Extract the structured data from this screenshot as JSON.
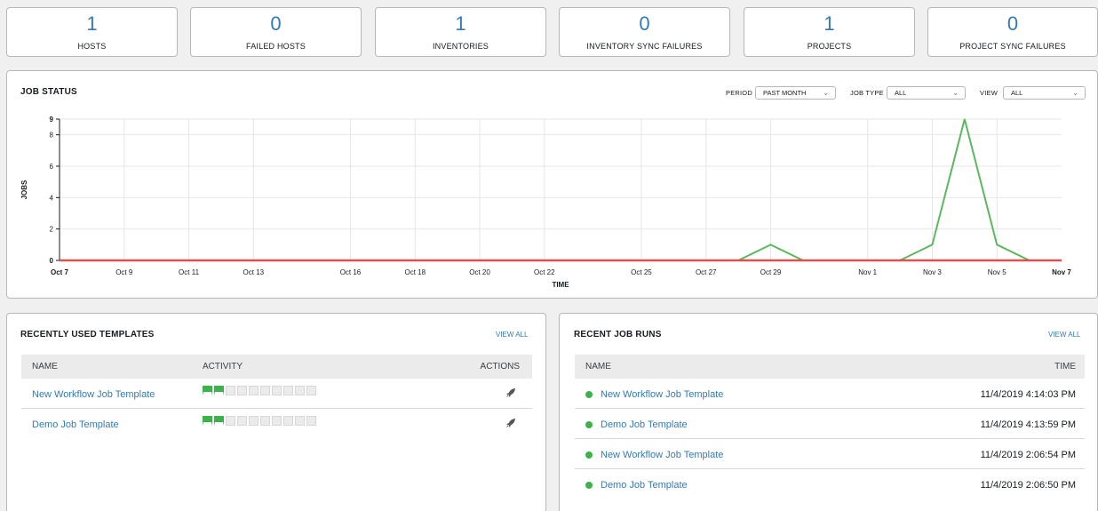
{
  "stats": [
    {
      "value": "1",
      "label": "HOSTS"
    },
    {
      "value": "0",
      "label": "FAILED HOSTS"
    },
    {
      "value": "1",
      "label": "INVENTORIES"
    },
    {
      "value": "0",
      "label": "INVENTORY SYNC FAILURES"
    },
    {
      "value": "1",
      "label": "PROJECTS"
    },
    {
      "value": "0",
      "label": "PROJECT SYNC FAILURES"
    }
  ],
  "job_status": {
    "title": "JOB STATUS",
    "filters": {
      "period_label": "PERIOD",
      "period_value": "PAST MONTH",
      "job_type_label": "JOB TYPE",
      "job_type_value": "ALL",
      "view_label": "VIEW",
      "view_value": "ALL"
    }
  },
  "chart_data": {
    "type": "line",
    "xlabel": "TIME",
    "ylabel": "JOBS",
    "ylim": [
      0,
      9
    ],
    "yticks": [
      0,
      2,
      4,
      6,
      8,
      9
    ],
    "x": [
      "Oct 7",
      "Oct 8",
      "Oct 9",
      "Oct 10",
      "Oct 11",
      "Oct 12",
      "Oct 13",
      "Oct 14",
      "Oct 15",
      "Oct 16",
      "Oct 17",
      "Oct 18",
      "Oct 19",
      "Oct 20",
      "Oct 21",
      "Oct 22",
      "Oct 23",
      "Oct 24",
      "Oct 25",
      "Oct 26",
      "Oct 27",
      "Oct 28",
      "Oct 29",
      "Oct 30",
      "Oct 31",
      "Nov 1",
      "Nov 2",
      "Nov 3",
      "Nov 4",
      "Nov 5",
      "Nov 6",
      "Nov 7"
    ],
    "xtick_labels": [
      "Oct 7",
      "Oct 9",
      "Oct 11",
      "Oct 13",
      "Oct 16",
      "Oct 18",
      "Oct 20",
      "Oct 22",
      "Oct 25",
      "Oct 27",
      "Oct 29",
      "Nov 1",
      "Nov 3",
      "Nov 5",
      "Nov 7"
    ],
    "bold_xticks": [
      "Oct 7",
      "Nov 7"
    ],
    "series": [
      {
        "color": "#5cb85c",
        "values": [
          0,
          0,
          0,
          0,
          0,
          0,
          0,
          0,
          0,
          0,
          0,
          0,
          0,
          0,
          0,
          0,
          0,
          0,
          0,
          0,
          0,
          0,
          1,
          0,
          0,
          0,
          0,
          1,
          9,
          1,
          0,
          0
        ]
      },
      {
        "color": "#d9534f",
        "values": [
          0,
          0,
          0,
          0,
          0,
          0,
          0,
          0,
          0,
          0,
          0,
          0,
          0,
          0,
          0,
          0,
          0,
          0,
          0,
          0,
          0,
          0,
          0,
          0,
          0,
          0,
          0,
          0,
          0,
          0,
          0,
          0
        ]
      }
    ],
    "grid": true
  },
  "templates": {
    "title": "RECENTLY USED TEMPLATES",
    "view_all": "VIEW ALL",
    "columns": {
      "name": "NAME",
      "activity": "ACTIVITY",
      "actions": "ACTIONS"
    },
    "rows": [
      {
        "name": "New Workflow Job Template",
        "activity": [
          "success",
          "success",
          "none",
          "none",
          "none",
          "none",
          "none",
          "none",
          "none",
          "none"
        ]
      },
      {
        "name": "Demo Job Template",
        "activity": [
          "success",
          "success",
          "none",
          "none",
          "none",
          "none",
          "none",
          "none",
          "none",
          "none"
        ]
      }
    ]
  },
  "job_runs": {
    "title": "RECENT JOB RUNS",
    "view_all": "VIEW ALL",
    "columns": {
      "name": "NAME",
      "time": "TIME"
    },
    "rows": [
      {
        "name": "New Workflow Job Template",
        "time": "11/4/2019 4:14:03 PM",
        "status": "successful"
      },
      {
        "name": "Demo Job Template",
        "time": "11/4/2019 4:13:59 PM",
        "status": "successful"
      },
      {
        "name": "New Workflow Job Template",
        "time": "11/4/2019 2:06:54 PM",
        "status": "successful"
      },
      {
        "name": "Demo Job Template",
        "time": "11/4/2019 2:06:50 PM",
        "status": "successful"
      }
    ]
  },
  "colors": {
    "link": "#337ab7",
    "success": "#3cb34a",
    "failed": "#d9534f"
  }
}
